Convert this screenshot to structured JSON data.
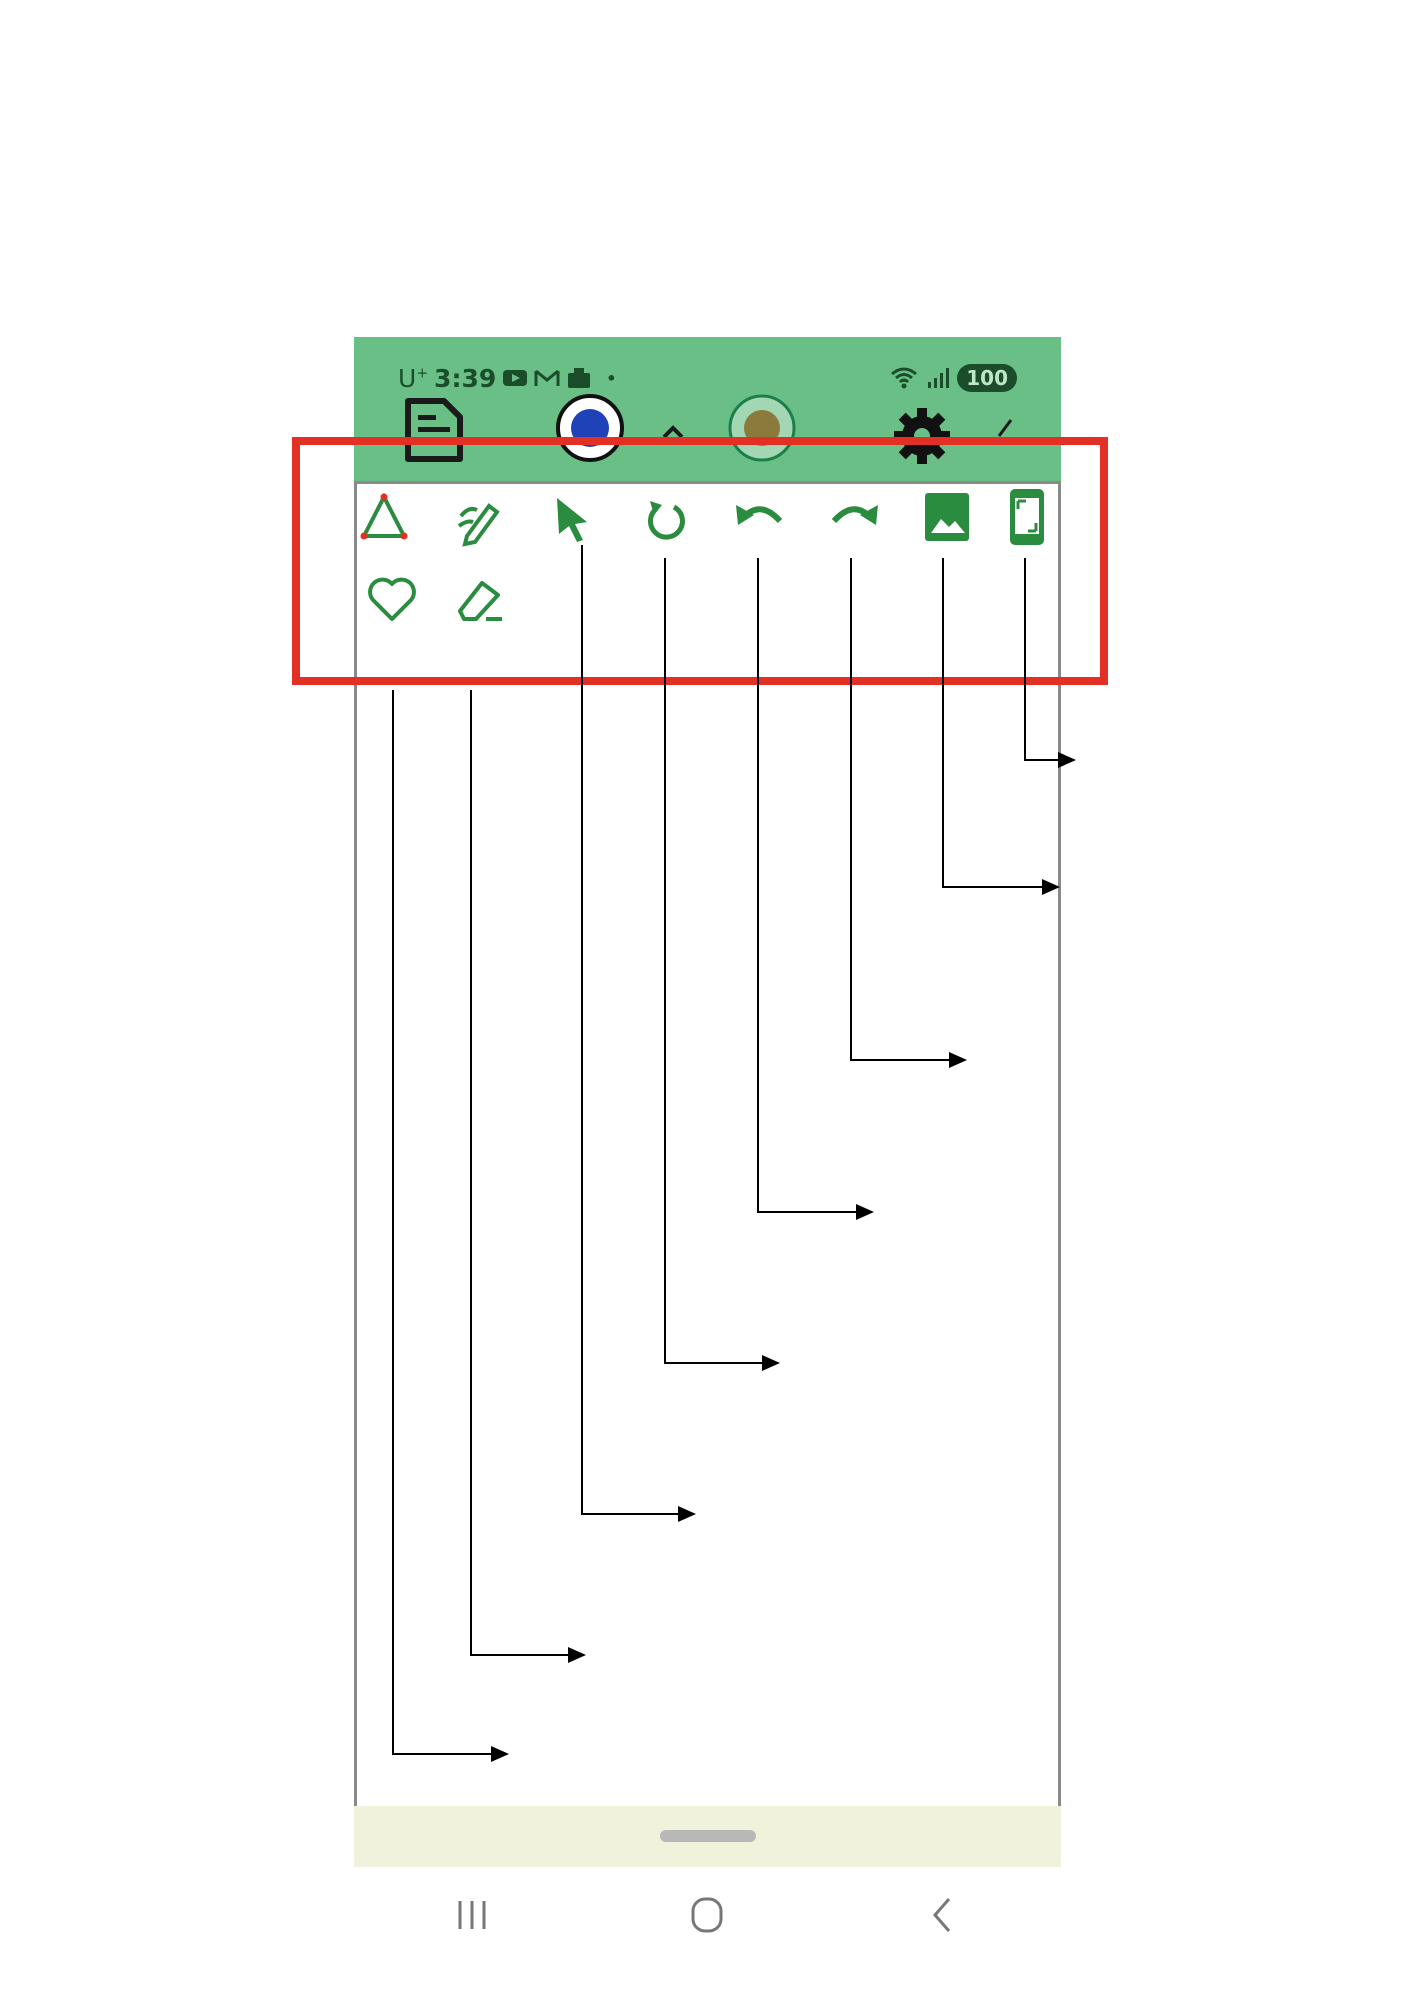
{
  "status_bar": {
    "carrier": "U",
    "carrier_sup": "+",
    "time": "3:39",
    "dot": "•",
    "battery": "100"
  },
  "colors": {
    "header_green": "#6abf87",
    "icon_green": "#2a8c3f",
    "highlight_red": "#e33024",
    "bottom_sheet": "#f1f2dc"
  },
  "header_icons": [
    "document-icon",
    "blue-color-dot-icon",
    "chevron-up-icon",
    "olive-color-dot-icon",
    "gear-icon",
    "check-icon"
  ],
  "toolbar": {
    "row1": [
      "shape-triangle-icon",
      "pen-tool-icon",
      "select-pointer-icon",
      "rotate-icon",
      "undo-icon",
      "redo-icon",
      "image-icon",
      "screen-icon"
    ],
    "row2": [
      "heart-icon",
      "eraser-icon"
    ]
  },
  "system_nav": [
    "recents-icon",
    "home-icon",
    "back-icon"
  ]
}
